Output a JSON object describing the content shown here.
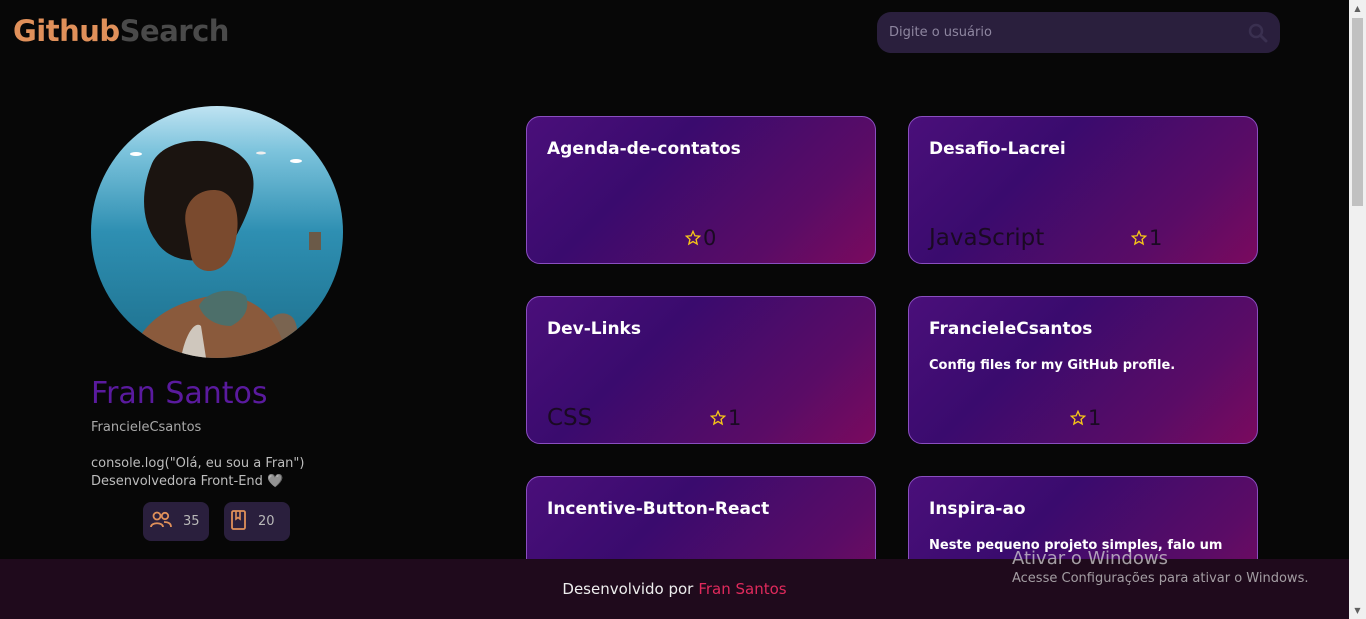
{
  "header": {
    "logo_part1": "Github",
    "logo_part2": "Search",
    "search_placeholder": "Digite o usuário",
    "search_icon": "search-icon"
  },
  "profile": {
    "name": "Fran Santos",
    "login": "FrancieleCsantos",
    "bio": "console.log(\"Olá, eu sou a Fran\")\nDesenvolvedora Front-End 🩶",
    "followers": "35",
    "repos": "20",
    "followers_icon": "users-icon",
    "repos_icon": "book-icon"
  },
  "repos": [
    {
      "name": "Agenda-de-contatos",
      "description": "",
      "language": "",
      "stars": "0"
    },
    {
      "name": "Desafio-Lacrei",
      "description": "",
      "language": "JavaScript",
      "stars": "1"
    },
    {
      "name": "Dev-Links",
      "description": "",
      "language": "CSS",
      "stars": "1"
    },
    {
      "name": "FrancieleCsantos",
      "description": "Config files for my GitHub profile.",
      "language": "",
      "stars": "1"
    },
    {
      "name": "Incentive-Button-React",
      "description": "",
      "language": "",
      "stars": ""
    },
    {
      "name": "Inspira-ao",
      "description": "Neste pequeno projeto simples, falo um",
      "language": "",
      "stars": ""
    }
  ],
  "footer": {
    "text": "Desenvolvido por",
    "author": "Fran Santos"
  },
  "watermark": {
    "line1": "Ativar o Windows",
    "line2": "Acesse Configurações para ativar o Windows."
  },
  "colors": {
    "accent": "#e0905a",
    "name": "#5a1a9e",
    "footer_link": "#e02a5c",
    "star": "#f5c518"
  }
}
